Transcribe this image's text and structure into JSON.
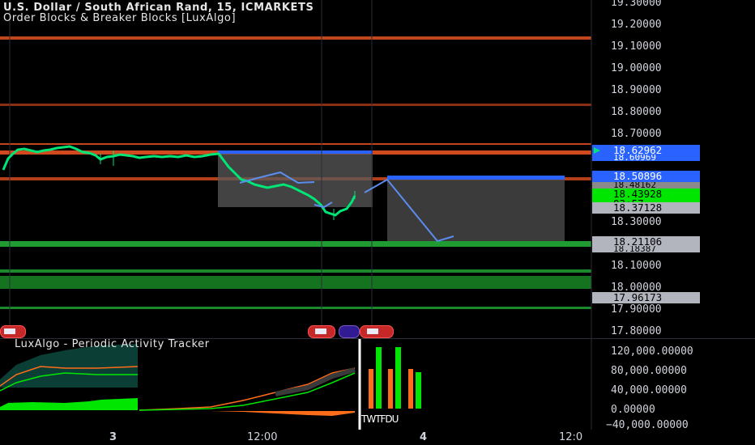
{
  "header": {
    "symbol_line": "U.S. Dollar / South African Rand, 15, ICMARKETS",
    "indicator_line": "Order Blocks & Breaker Blocks [LuxAlgo]",
    "oscillator_title": "LuxAlgo - Periodic Activity Tracker"
  },
  "price_axis": {
    "labels": [
      "19.30000",
      "19.20000",
      "19.10000",
      "19.00000",
      "18.90000",
      "18.80000",
      "18.70000",
      "18.30000",
      "18.10000",
      "18.00000",
      "17.90000",
      "17.80000"
    ]
  },
  "price_tags": {
    "current_top": "18.62962",
    "current_top_under": "18.60969",
    "blue_level": "18.50896",
    "blue_level_under": "18.48162",
    "last_price": "18.43928",
    "countdown": "03:57",
    "lower_level": "18.37128",
    "support_1": "18.21106",
    "support_2": "18.18387",
    "support_3": "17.96173"
  },
  "oscillator_axis": {
    "labels": [
      "120,000.00000",
      "80,000.00000",
      "40,000.00000",
      "0.00000",
      "−40,000.00000"
    ],
    "bar_labels": "TWTFDU"
  },
  "time_axis": {
    "labels": [
      "3",
      "12:00",
      "4",
      "12:0"
    ]
  },
  "colors": {
    "background": "#000000",
    "bull_candle": "#00e676",
    "resistance_line": "#ff5722",
    "order_block_blue": "#2962ff",
    "support_green": "#1b8a2c",
    "projection_line": "#5b8def",
    "bar_orange": "#ff6d1a",
    "bar_green": "#00e600"
  },
  "icons": [
    "flag-event-icon",
    "flag-event-icon",
    "flag-event-icon",
    "flag-event-icon"
  ]
}
